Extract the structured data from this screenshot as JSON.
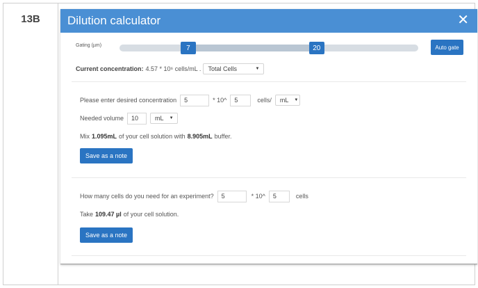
{
  "figure_label": "13B",
  "dialog": {
    "title": "Dilution calculator",
    "close_icon": "close-icon",
    "close_glyph": "✕"
  },
  "gating": {
    "label": "Gating (µm)",
    "min_value": "7",
    "max_value": "20",
    "min_fraction": 0.23,
    "max_fraction": 0.66,
    "auto_gate_label": "Auto gate"
  },
  "current_concentration": {
    "label": "Current concentration:",
    "value": "4.57 * 10⁶ cells/mL .",
    "cell_type": "Total Cells"
  },
  "desired": {
    "prompt": "Please enter desired concentration",
    "mantissa": "5",
    "times_ten": "* 10^",
    "exponent": "5",
    "unit_prefix": "cells/",
    "unit": "mL",
    "volume_label": "Needed volume",
    "volume_value": "10",
    "volume_unit": "mL",
    "mix_prefix": "Mix",
    "mix_amount": "1.095mL",
    "mix_middle": "of your cell solution with",
    "buffer_amount": "8.905mL",
    "mix_suffix": "buffer.",
    "save_label": "Save as a note"
  },
  "experiment": {
    "prompt": "How many cells do you need for an experiment?",
    "mantissa": "5",
    "times_ten": "* 10^",
    "exponent": "5",
    "unit": "cells",
    "take_prefix": "Take",
    "take_amount": "109.47 µl",
    "take_suffix": "of your cell solution.",
    "save_label": "Save as a note"
  },
  "colors": {
    "header": "#4a8fd4",
    "button": "#2a74c2",
    "track": "#d7dde3"
  }
}
